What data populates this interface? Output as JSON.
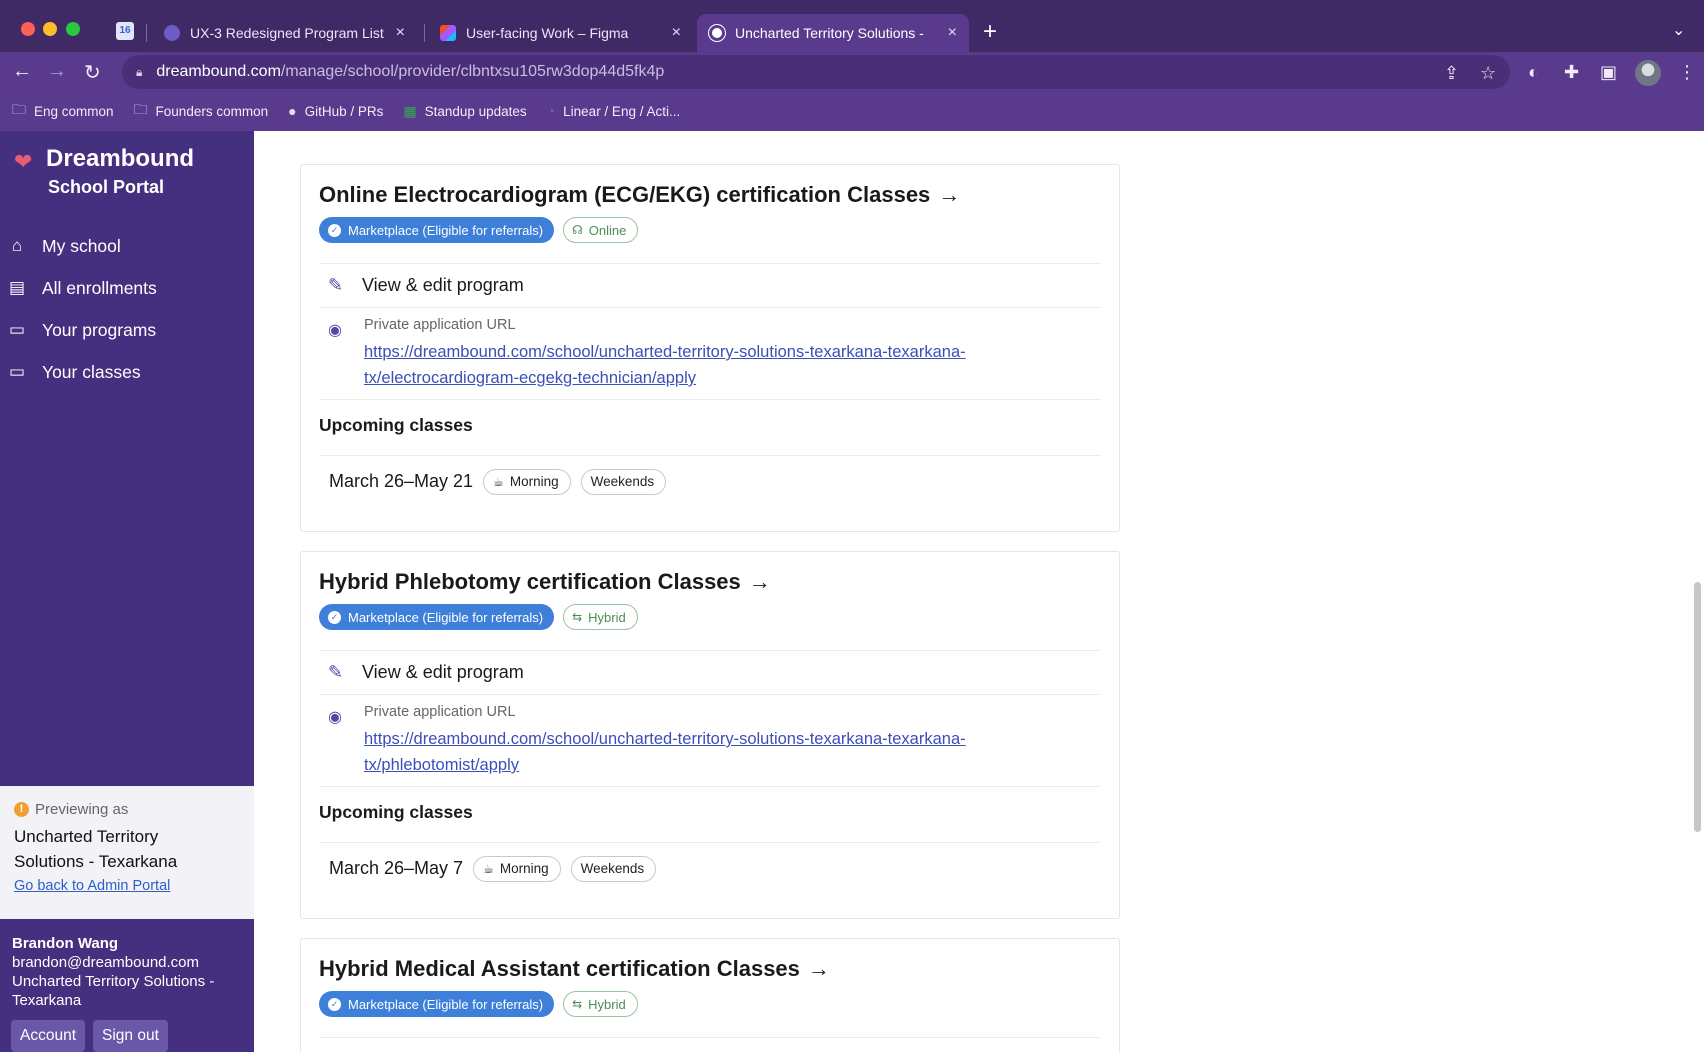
{
  "browser": {
    "tabs": [
      {
        "title": "UX-3 Redesigned Program List",
        "close": "×",
        "favicon_color": "#6b5cc6"
      },
      {
        "title": "User-facing Work – Figma",
        "close": "×",
        "favicon_color": "#f24e1e"
      },
      {
        "title": "Uncharted Territory Solutions -",
        "close": "×",
        "favicon_color": "#ffffff"
      }
    ],
    "pinned_tab_label": "16",
    "new_tab": "+",
    "url_host": "dreambound.com",
    "url_path": "/manage/school/provider/clbntxsu105rw3dop44d5fk4p",
    "bookmarks": [
      {
        "label": "Eng common",
        "icon": "folder-icon"
      },
      {
        "label": "Founders common",
        "icon": "folder-icon"
      },
      {
        "label": "GitHub / PRs",
        "icon": "github-icon"
      },
      {
        "label": "Standup updates",
        "icon": "sheets-icon"
      },
      {
        "label": "Linear / Eng / Acti...",
        "icon": "linear-icon"
      }
    ]
  },
  "sidebar": {
    "brand_name": "Dreambound",
    "brand_sub": "School Portal",
    "items": [
      {
        "label": "My school",
        "icon": "home-icon"
      },
      {
        "label": "All enrollments",
        "icon": "document-icon"
      },
      {
        "label": "Your programs",
        "icon": "laptop-icon"
      },
      {
        "label": "Your classes",
        "icon": "laptop-icon"
      }
    ],
    "preview": {
      "label": "Previewing as",
      "school_line1": "Uncharted Territory",
      "school_line2": "Solutions - Texarkana",
      "back_link": "Go back to Admin Portal"
    },
    "user": {
      "name": "Brandon Wang",
      "email": "brandon@dreambound.com",
      "org_line1": "Uncharted Territory Solutions -",
      "org_line2": "Texarkana"
    },
    "account_button": "Account",
    "signout_button": "Sign out"
  },
  "programs": [
    {
      "title": "Online Electrocardiogram (ECG/EKG) certification Classes",
      "arrow": "→",
      "marketplace_badge": "Marketplace (Eligible for referrals)",
      "mode": "Online",
      "mode_icon": "headset-icon",
      "edit_label": "View & edit program",
      "url_label": "Private application URL",
      "url_line1": "https://dreambound.com/school/uncharted-territory-solutions-texarkana-texarkana-",
      "url_line2": "tx/electrocardiogram-ecgekg-technician/apply",
      "upcoming_heading": "Upcoming classes",
      "classes": [
        {
          "date": "March 26–May 21",
          "time_tag": "Morning",
          "day_tag": "Weekends"
        }
      ]
    },
    {
      "title": "Hybrid Phlebotomy certification Classes",
      "arrow": "→",
      "marketplace_badge": "Marketplace (Eligible for referrals)",
      "mode": "Hybrid",
      "mode_icon": "hybrid-icon",
      "edit_label": "View & edit program",
      "url_label": "Private application URL",
      "url_line1": "https://dreambound.com/school/uncharted-territory-solutions-texarkana-texarkana-",
      "url_line2": "tx/phlebotomist/apply",
      "upcoming_heading": "Upcoming classes",
      "classes": [
        {
          "date": "March 26–May 7",
          "time_tag": "Morning",
          "day_tag": "Weekends"
        }
      ]
    },
    {
      "title": "Hybrid Medical Assistant certification Classes",
      "arrow": "→",
      "marketplace_badge": "Marketplace (Eligible for referrals)",
      "mode": "Hybrid",
      "mode_icon": "hybrid-icon"
    }
  ],
  "colors": {
    "sidebar_bg": "#452f7f",
    "chrome_bg": "#5a3a8c",
    "badge_blue": "#3d7fd9",
    "mode_green": "#4c8d55",
    "link": "#3a4fb8"
  }
}
